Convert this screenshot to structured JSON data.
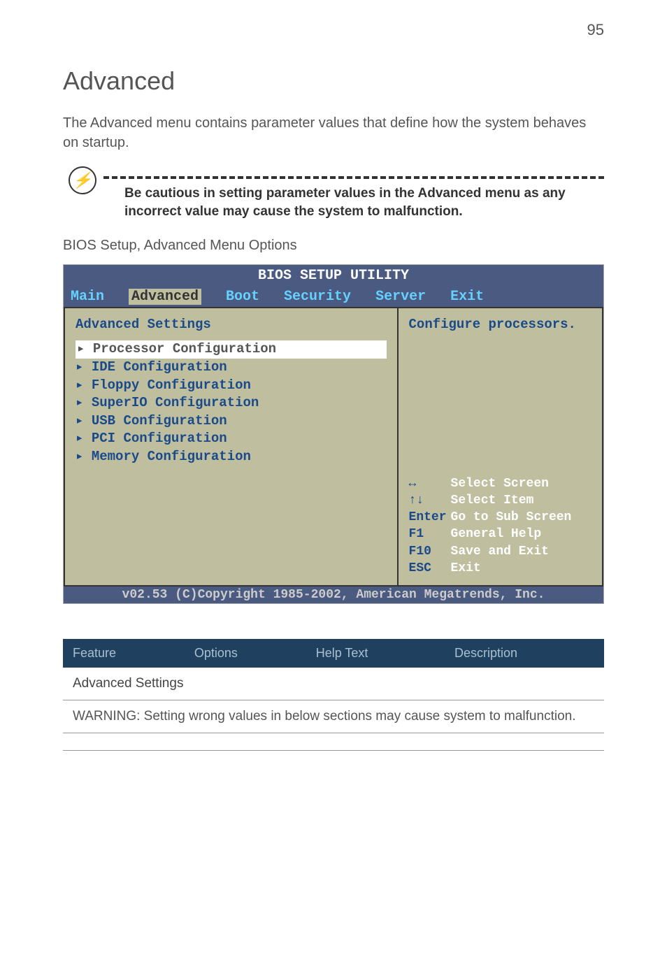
{
  "page_number": "95",
  "title": "Advanced",
  "intro": "The Advanced menu contains parameter values that define how the system behaves on startup.",
  "note": {
    "text": "Be cautious in setting parameter values in the Advanced menu as any incorrect value may cause the system to malfunction."
  },
  "section_label": "BIOS Setup, Advanced Menu Options",
  "bios": {
    "title": "BIOS SETUP UTILITY",
    "tabs": [
      "Main",
      "Advanced",
      "Boot",
      "Security",
      "Server",
      "Exit"
    ],
    "active_tab": "Advanced",
    "heading": "Advanced Settings",
    "items": [
      "Processor Configuration",
      "IDE Configuration",
      "Floppy Configuration",
      "SuperIO Configuration",
      "USB Configuration",
      "PCI Configuration",
      "Memory Configuration"
    ],
    "selected_item_index": 0,
    "help_desc": "Configure processors.",
    "keys": [
      {
        "key": "↔",
        "text": "Select Screen"
      },
      {
        "key": "↑↓",
        "text": "Select Item"
      },
      {
        "key": "Enter",
        "text": "Go to Sub Screen"
      },
      {
        "key": "F1",
        "text": "General Help"
      },
      {
        "key": "F10",
        "text": "Save and Exit"
      },
      {
        "key": "ESC",
        "text": "Exit"
      }
    ],
    "footer": "v02.53 (C)Copyright 1985-2002, American Megatrends, Inc."
  },
  "table": {
    "headers": [
      "Feature",
      "Options",
      "Help Text",
      "Description"
    ],
    "section": "Advanced Settings",
    "warning": "WARNING: Setting wrong values in below sections may cause system to malfunction."
  }
}
